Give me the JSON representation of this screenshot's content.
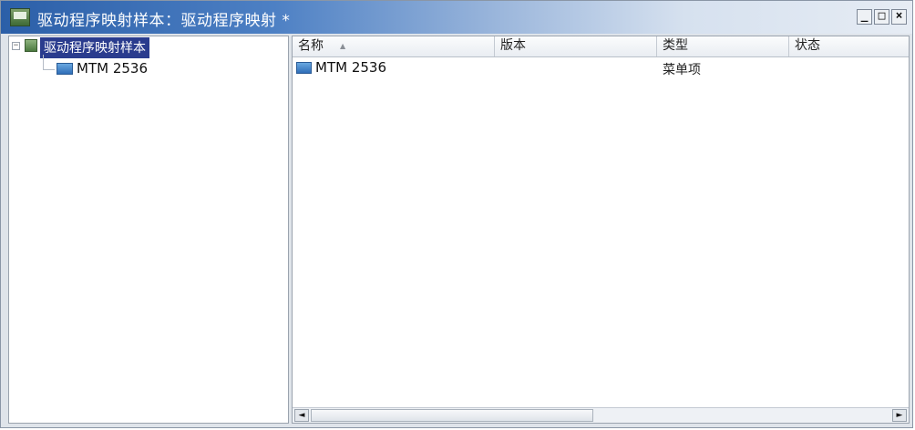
{
  "window": {
    "title": "驱动程序映射样本：驱动程序映射 *",
    "buttons": {
      "minimize": "_",
      "maximize": "□",
      "close": "×"
    }
  },
  "tree": {
    "expander": "−",
    "root_label": "驱动程序映射样本",
    "child_label": "MTM 2536"
  },
  "list": {
    "columns": [
      "名称",
      "版本",
      "类型",
      "状态"
    ],
    "rows": [
      {
        "name": "MTM 2536",
        "version": "",
        "type": "菜单项",
        "status": ""
      }
    ]
  },
  "scrollbar": {
    "left_arrow": "◄",
    "right_arrow": "►"
  },
  "colors": {
    "title_gradient_start": "#2b5fa8",
    "selection": "#2a3c8e",
    "window_bg": "#dfe4ea"
  }
}
